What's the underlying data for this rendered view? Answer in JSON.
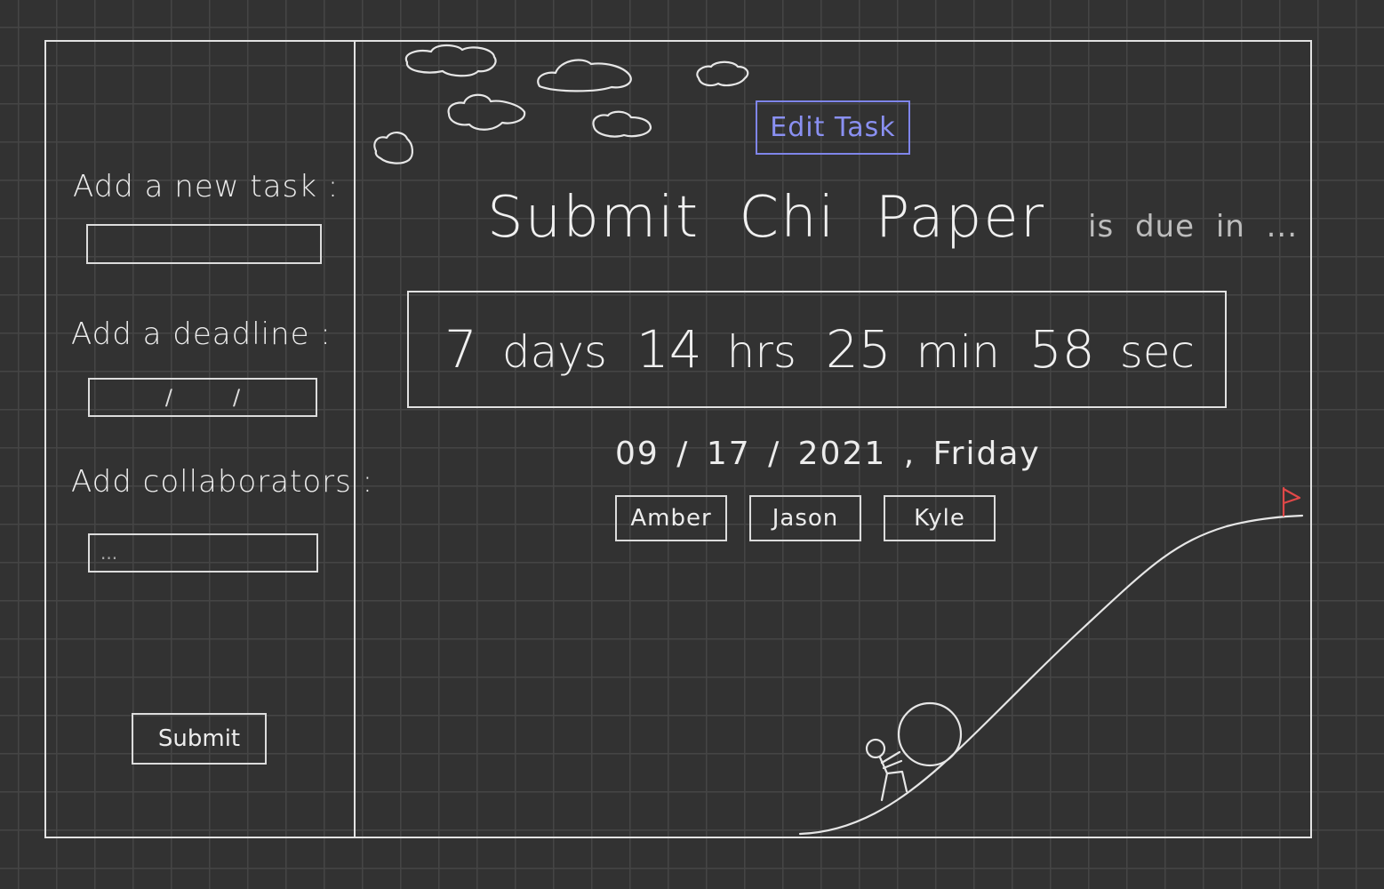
{
  "sidebar": {
    "task_label": "Add a new task :",
    "task_input_value": "",
    "deadline_label": "Add a deadline :",
    "deadline_separator_1": "/",
    "deadline_separator_2": "/",
    "collaborators_label": "Add collaborators :",
    "collaborators_placeholder": "...",
    "submit_label": "Submit"
  },
  "main": {
    "edit_button_label": "Edit Task",
    "task_name": "Submit Chi Paper",
    "due_suffix": "is due in ...",
    "countdown": {
      "days": "7",
      "days_unit": "days",
      "hours": "14",
      "hours_unit": "hrs",
      "minutes": "25",
      "minutes_unit": "min",
      "seconds": "58",
      "seconds_unit": "sec"
    },
    "due_date": "09 / 17 / 2021 , Friday",
    "collaborators": [
      "Amber",
      "Jason",
      "Kyle"
    ]
  },
  "colors": {
    "background": "#323232",
    "grid": "#454545",
    "line": "#e2e2e2",
    "accent": "#8a90f2",
    "flag": "#e04848"
  },
  "icons": {
    "clouds": "cloud-icon",
    "hill": "hill-illustration",
    "person": "person-pushing-boulder-icon",
    "flag": "goal-flag-icon"
  }
}
